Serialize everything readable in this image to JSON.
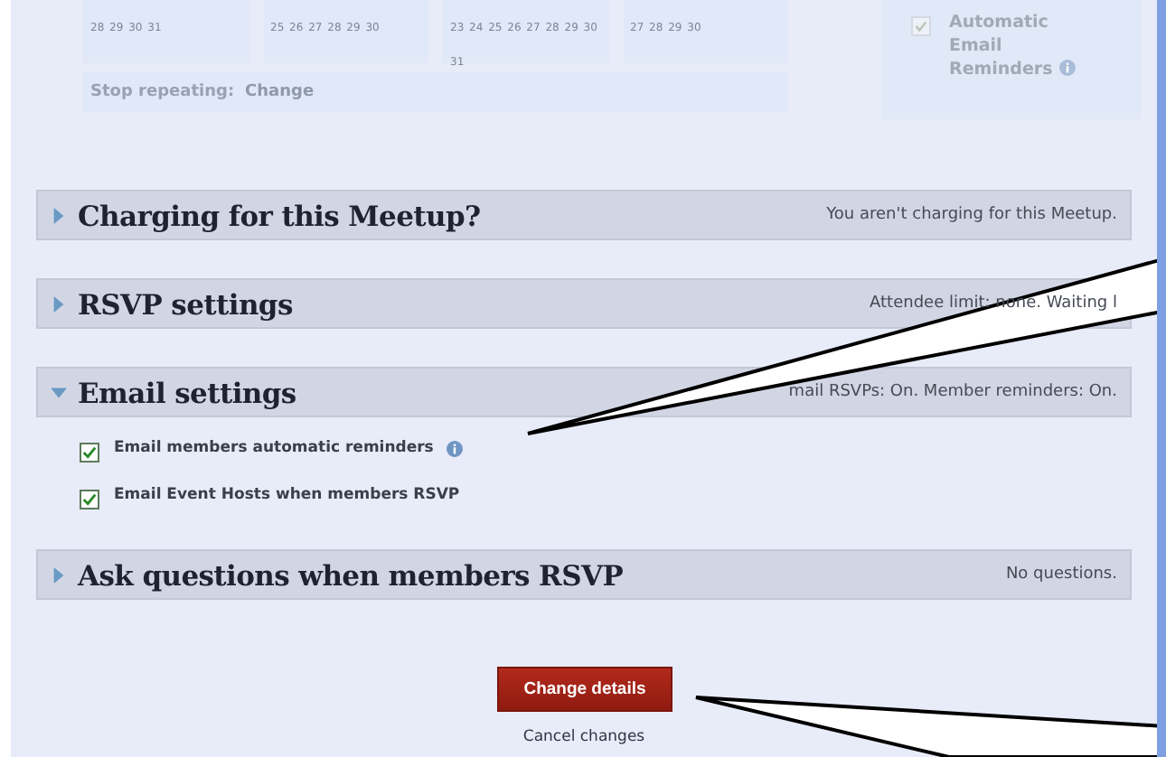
{
  "schedule": {
    "calendars": [
      {
        "days": "28 29 30 31"
      },
      {
        "days": "25 26 27 28 29 30"
      },
      {
        "days": "23 24 25 26 27 28 29 30 31"
      },
      {
        "days": "27 28 29 30"
      }
    ],
    "stop_repeating": {
      "label": "Stop repeating:",
      "link": "Change"
    },
    "reminder_option": {
      "label": "Automatic Email Reminders",
      "checked": true
    }
  },
  "sections": [
    {
      "title": "Charging for this Meetup?",
      "summary": "You aren't charging for this Meetup.",
      "expanded": false
    },
    {
      "title": "RSVP settings",
      "summary": "Attendee limit: none. Waiting l",
      "expanded": false
    },
    {
      "title": "Email settings",
      "summary": "mail RSVPs: On. Member reminders: On.",
      "expanded": true,
      "options": [
        {
          "label": "Email members automatic reminders",
          "checked": true,
          "info": true
        },
        {
          "label": "Email Event Hosts when members RSVP",
          "checked": true,
          "info": false
        }
      ]
    },
    {
      "title": "Ask questions when members RSVP",
      "summary": "No questions.",
      "expanded": false
    }
  ],
  "submit": {
    "label": "Change details"
  },
  "cancel": {
    "label": "Cancel changes"
  }
}
